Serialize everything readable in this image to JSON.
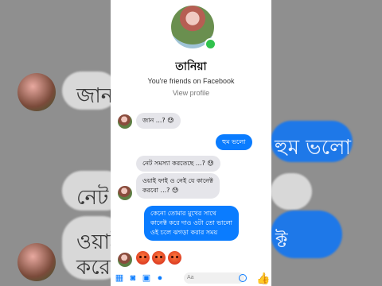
{
  "background": {
    "bg_text_1": "জান",
    "bg_text_2": "নেট",
    "bg_text_3": "ওয়াই",
    "bg_text_4": "করে",
    "bg_text_5": "হুম ভলো",
    "bg_text_6": "ক্ট"
  },
  "profile": {
    "name": "তানিয়া",
    "friends_text": "You're friends on Facebook",
    "view_profile": "View profile",
    "online": true
  },
  "messages": [
    {
      "from": "them",
      "text": "জান ...? 😓"
    },
    {
      "from": "me",
      "text": "হুম ভলো"
    },
    {
      "from": "them",
      "text": "নেট সমস্যা করতেছে ...? 😓"
    },
    {
      "from": "them",
      "text": "ওয়াই ফাই ও নেই যে কানেক্ট\nকরবো ...? 😓"
    },
    {
      "from": "me",
      "text": "কেনো তোমার মুখের সাথে\nকানেক্ট করে দাও ওটা তো ভালো\nওই চলে ঝগড়া করার সময়"
    }
  ],
  "reactions": [
    "angry",
    "angry",
    "angry"
  ],
  "composer": {
    "placeholder": "Aa",
    "icons": [
      "apps-icon",
      "camera-icon",
      "gallery-icon",
      "mic-icon"
    ]
  },
  "colors": {
    "outgoing": "#0a7cff",
    "incoming": "#e5e5ea",
    "online": "#31c24d"
  }
}
